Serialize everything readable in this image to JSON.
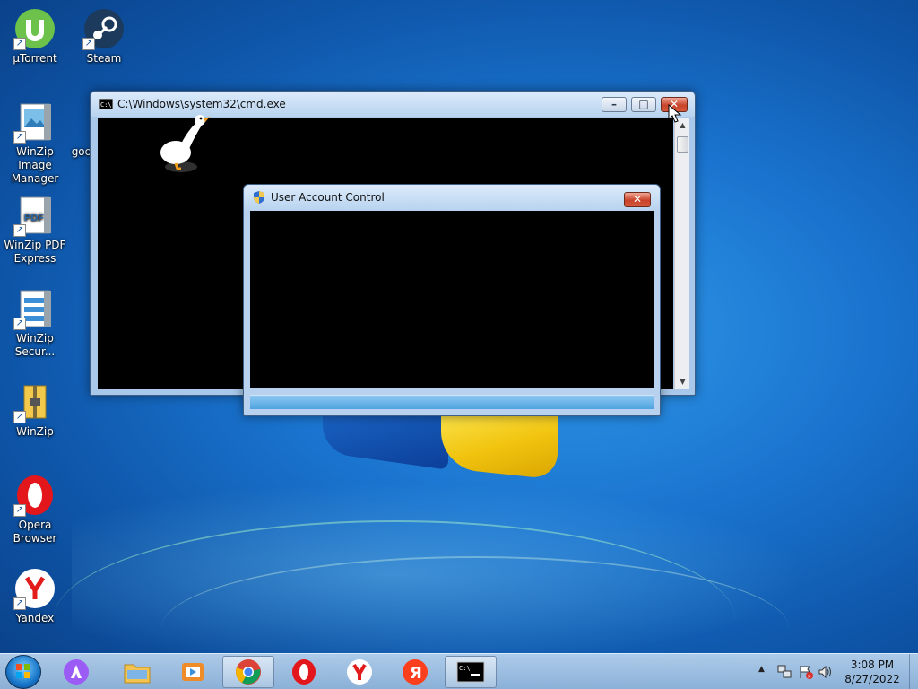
{
  "desktop": {
    "icons": [
      {
        "label": "µTorrent"
      },
      {
        "label": "Steam"
      },
      {
        "label": "WinZip Image Manager"
      },
      {
        "label": "goo"
      },
      {
        "label": "WinZip PDF Express"
      },
      {
        "label": "WinZip Secur..."
      },
      {
        "label": "WinZip"
      },
      {
        "label": "Opera Browser"
      },
      {
        "label": "Yandex"
      }
    ]
  },
  "cmd_window": {
    "title": "C:\\Windows\\system32\\cmd.exe",
    "icon": "console-icon"
  },
  "uac_window": {
    "title": "User Account Control",
    "icon": "shield-icon"
  },
  "taskbar": {
    "items": [
      {
        "name": "alice-assistant",
        "icon": "alice-icon"
      },
      {
        "name": "file-explorer",
        "icon": "folder-icon"
      },
      {
        "name": "media-player",
        "icon": "media-player-icon"
      },
      {
        "name": "chrome",
        "icon": "chrome-icon",
        "active": true
      },
      {
        "name": "opera",
        "icon": "opera-icon"
      },
      {
        "name": "yandex-browser",
        "icon": "yandex-browser-icon"
      },
      {
        "name": "yandex",
        "icon": "yandex-icon"
      },
      {
        "name": "command-prompt",
        "icon": "cmd-icon",
        "active": true
      }
    ],
    "clock": {
      "time": "3:08 PM",
      "date": "8/27/2022"
    }
  },
  "colors": {
    "accent": "#1a74cf",
    "close_button": "#c9432a",
    "console_bg": "#000000"
  }
}
